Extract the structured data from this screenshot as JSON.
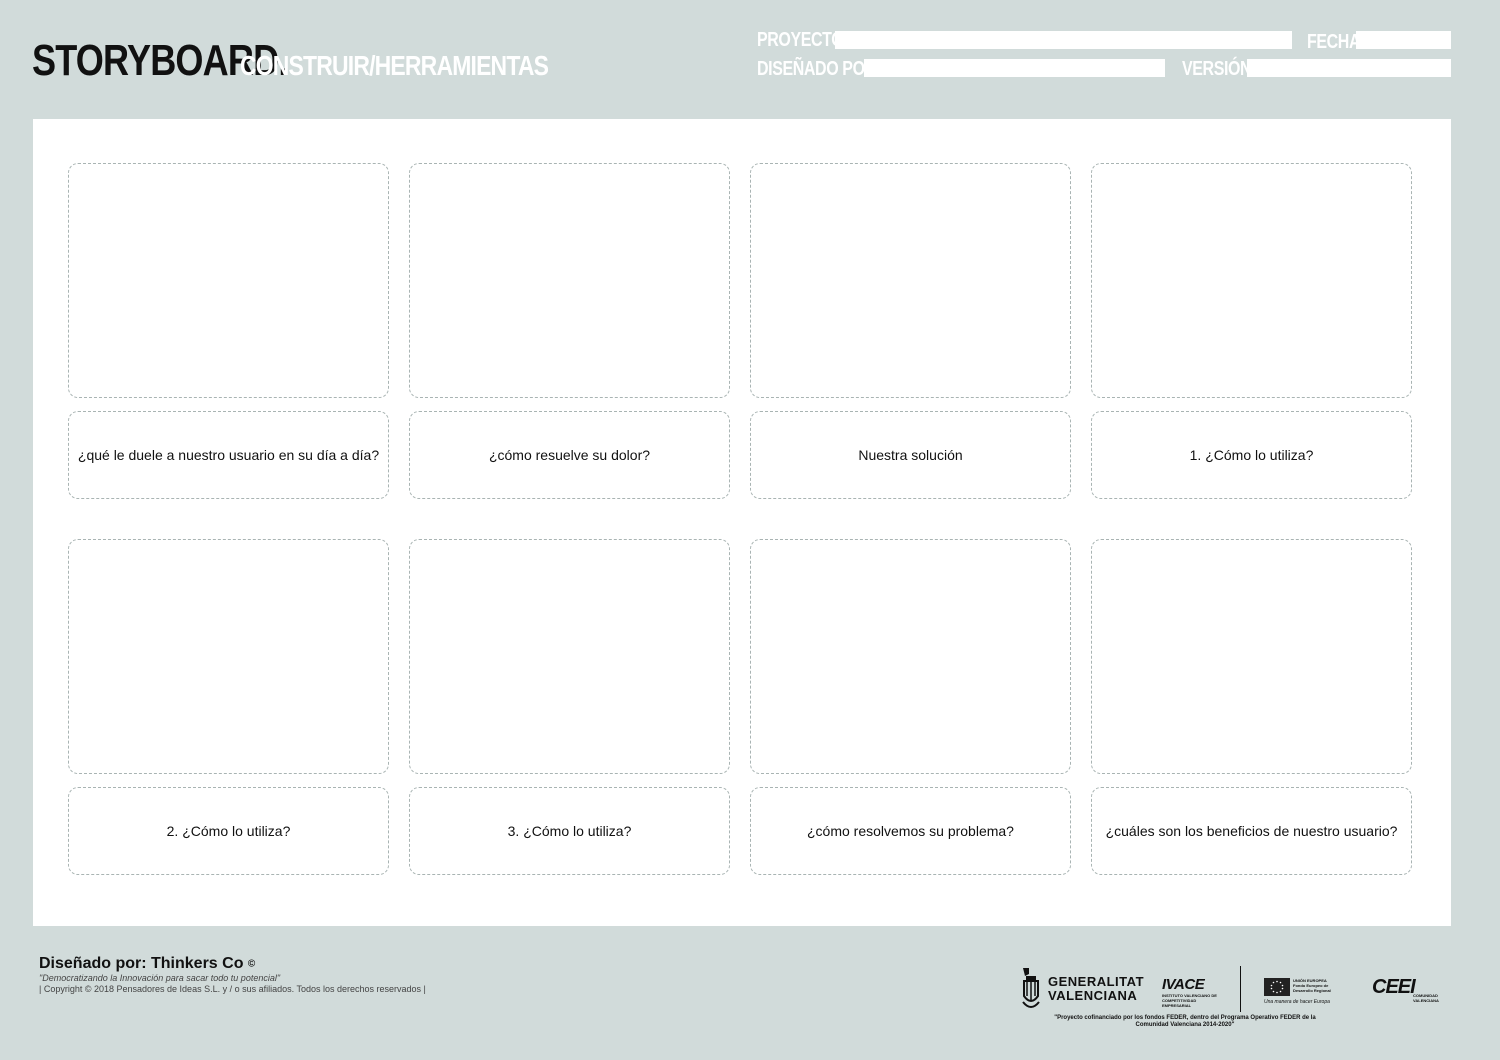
{
  "header": {
    "title_main": "STORYBOARD.",
    "title_sub": "CONSTRUIR/HERRAMIENTAS",
    "fields": {
      "proyecto": {
        "label": "PROYECTO",
        "value": ""
      },
      "fecha": {
        "label": "FECHA",
        "value": ""
      },
      "disenado_por": {
        "label": "DISEÑADO POR",
        "value": ""
      },
      "version": {
        "label": "VERSIÓN",
        "value": ""
      }
    }
  },
  "panels": [
    {
      "caption": "¿qué le duele a nuestro usuario en su día a día?"
    },
    {
      "caption": "¿cómo resuelve su dolor?"
    },
    {
      "caption": "Nuestra solución"
    },
    {
      "caption": "1. ¿Cómo lo utiliza?"
    },
    {
      "caption": "2. ¿Cómo lo utiliza?"
    },
    {
      "caption": "3. ¿Cómo lo utiliza?"
    },
    {
      "caption": "¿cómo resolvemos su problema?"
    },
    {
      "caption": "¿cuáles son los beneficios de nuestro usuario?"
    }
  ],
  "footer": {
    "credit_title": "Diseñado por: Thinkers Co",
    "copyright_symbol": "©",
    "tagline": "\"Democratizando la Innovación para sacar todo tu potencial\"",
    "copyright": "| Copyright © 2018 Pensadores de Ideas S.L.  y / o sus afiliados. Todos los derechos reservados |",
    "logos": {
      "gv_line1": "GENERALITAT",
      "gv_line2": "VALENCIANA",
      "ivace": "IVACE",
      "ivace_sub": "INSTITUTO VALENCIANO DE COMPETITIVIDAD EMPRESARIAL",
      "eu_line1": "UNIÓN EUROPEA",
      "eu_line2": "Fondo Europeo de Desarrollo Regional",
      "eu_tagline": "Una manera de hacer Europa",
      "ceei": "CEEI",
      "ceei_sub1": "COMUNIDAD",
      "ceei_sub2": "VALENCIANA",
      "feder_note": "\"Proyecto cofinanciado por los fondos FEDER, dentro del Programa Operativo FEDER de la Comunidad Valenciana 2014-2020\""
    }
  },
  "colors": {
    "background": "#d1dbda",
    "sheet": "#ffffff",
    "dashed_border": "#a9b4b3"
  }
}
